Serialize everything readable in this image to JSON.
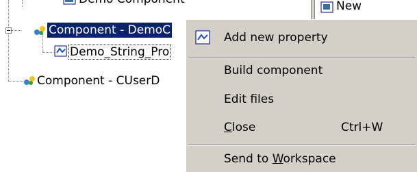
{
  "tree": {
    "top_item_label": "Demo Component",
    "selected_item_label": "Component - DemoC",
    "child_item_label": "Demo_String_Pro",
    "second_item_label": "Component - CUserD"
  },
  "right_pane": {
    "partial_label": "New"
  },
  "context_menu": {
    "add_property": "Add new property",
    "build_component": "Build component",
    "edit_files": "Edit files",
    "close_label_prefix": "",
    "close_label_mnemonic": "C",
    "close_label_rest": "lose",
    "close_shortcut": "Ctrl+W",
    "send_prefix": "Send to ",
    "send_mnemonic": "W",
    "send_rest": "orkspace"
  },
  "colors": {
    "selection": "#0a246a",
    "menu_bg": "#d4d0c8"
  },
  "icons": {
    "component": "component-icon",
    "property": "property-icon",
    "add_property": "add-property-icon"
  }
}
